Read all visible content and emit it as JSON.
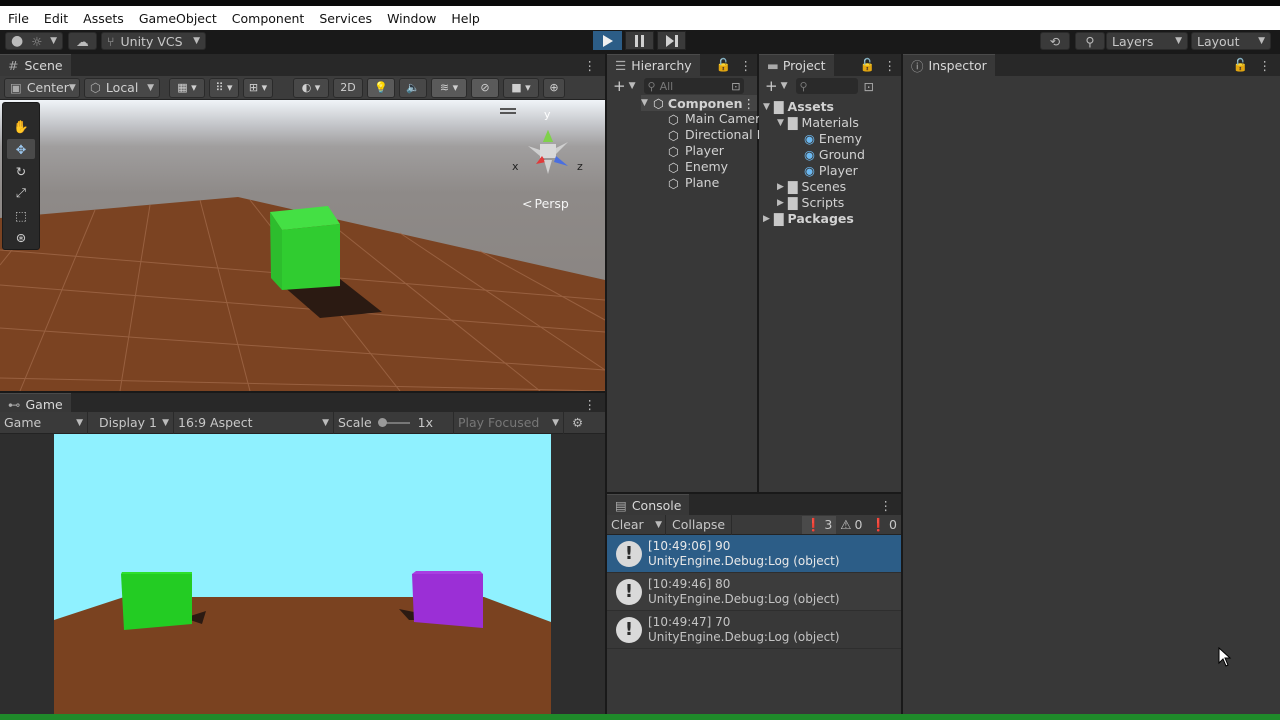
{
  "menu": [
    "File",
    "Edit",
    "Assets",
    "GameObject",
    "Component",
    "Services",
    "Window",
    "Help"
  ],
  "toolbar": {
    "account_glyph": "●",
    "version_control": "Unity VCS",
    "layers": "Layers",
    "layout": "Layout"
  },
  "scene": {
    "tab": "Scene",
    "pivot": "Center",
    "space": "Local",
    "mode_2d": "2D",
    "persp": "Persp",
    "axis_x": "x",
    "axis_y": "y",
    "axis_z": "z"
  },
  "game": {
    "tab": "Game",
    "view_select": "Game",
    "display": "Display 1",
    "aspect": "16:9 Aspect",
    "scale_label": "Scale",
    "scale_value": "1x",
    "play_focused": "Play Focused"
  },
  "hierarchy": {
    "tab": "Hierarchy",
    "search_placeholder": "All",
    "scene_name": "Componen",
    "items": [
      "Main Camer",
      "Directional L",
      "Player",
      "Enemy",
      "Plane"
    ]
  },
  "project": {
    "tab": "Project",
    "assets": "Assets",
    "materials": "Materials",
    "material_items": [
      "Enemy",
      "Ground",
      "Player"
    ],
    "scenes": "Scenes",
    "scripts": "Scripts",
    "packages": "Packages"
  },
  "inspector": {
    "tab": "Inspector"
  },
  "console": {
    "tab": "Console",
    "clear": "Clear",
    "collapse": "Collapse",
    "counts": {
      "log": "3",
      "warn": "0",
      "error": "0"
    },
    "entries": [
      {
        "line1": "[10:49:06] 90",
        "line2": "UnityEngine.Debug:Log (object)"
      },
      {
        "line1": "[10:49:46] 80",
        "line2": "UnityEngine.Debug:Log (object)"
      },
      {
        "line1": "[10:49:47] 70",
        "line2": "UnityEngine.Debug:Log (object)"
      }
    ]
  },
  "colors": {
    "accent": "#2c5d87",
    "player": "#22cc22",
    "enemy": "#9b2fd6",
    "ground": "#7a4220",
    "sky": "#8ff1ff"
  }
}
